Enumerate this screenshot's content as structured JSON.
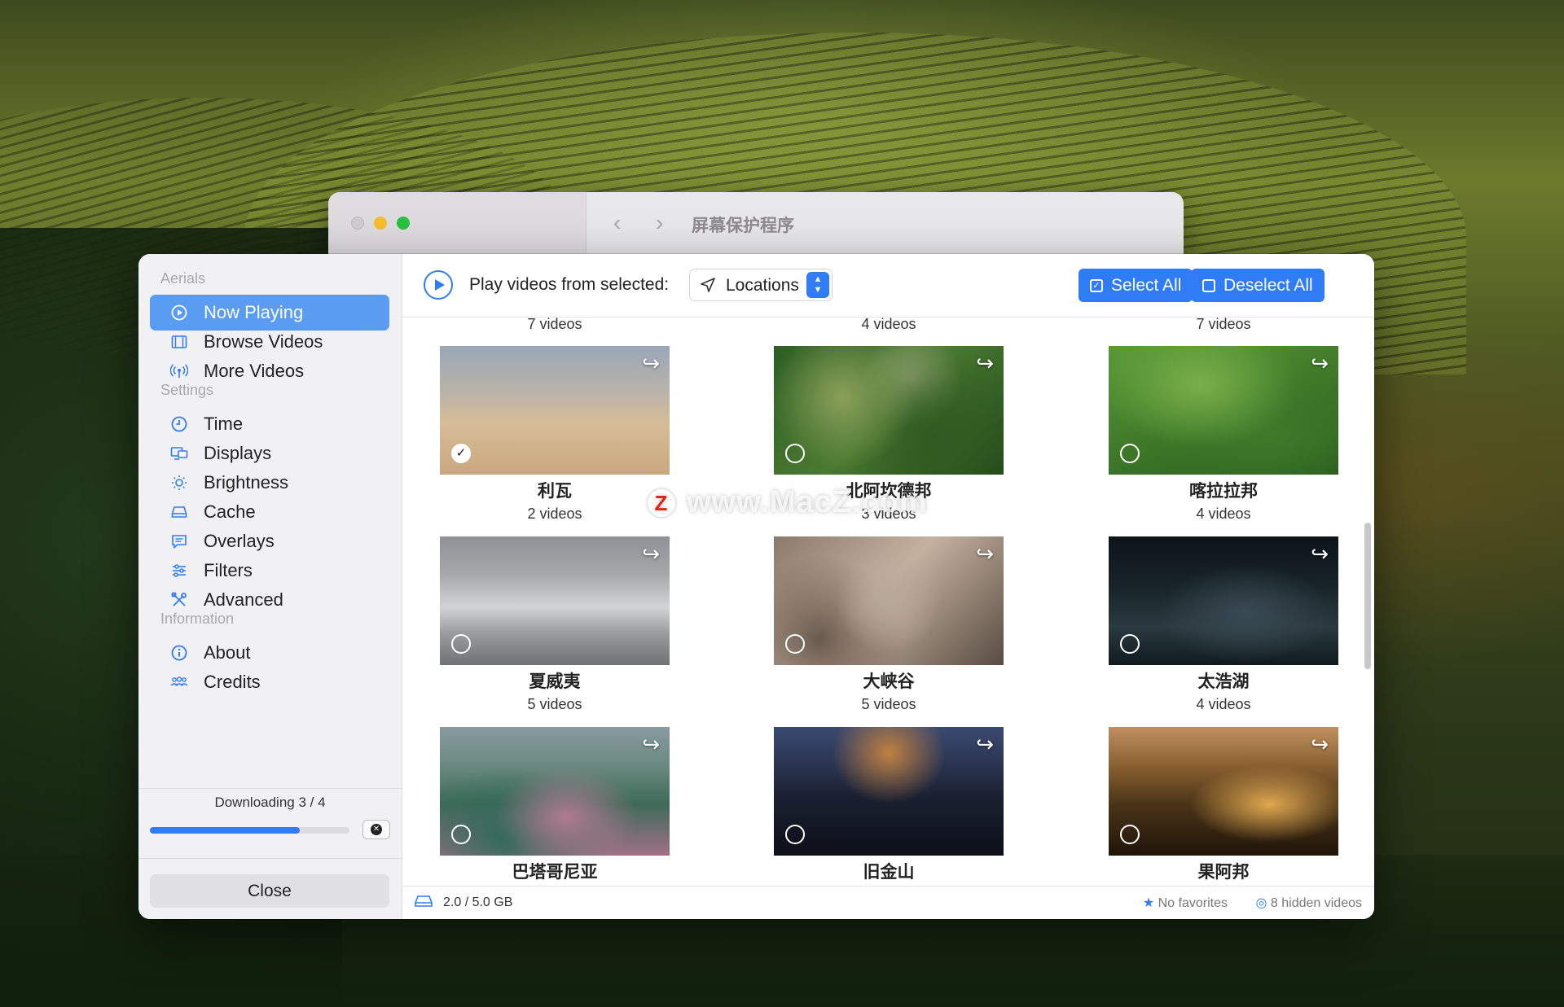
{
  "background_window": {
    "title": "屏幕保护程序"
  },
  "sidebar": {
    "sections": [
      {
        "label": "Aerials",
        "items": [
          {
            "label": "Now Playing",
            "icon": "play-circle-icon",
            "active": true
          },
          {
            "label": "Browse Videos",
            "icon": "film-icon"
          },
          {
            "label": "More Videos",
            "icon": "broadcast-icon"
          }
        ]
      },
      {
        "label": "Settings",
        "items": [
          {
            "label": "Time",
            "icon": "clock-icon"
          },
          {
            "label": "Displays",
            "icon": "displays-icon"
          },
          {
            "label": "Brightness",
            "icon": "sun-icon"
          },
          {
            "label": "Cache",
            "icon": "disk-icon"
          },
          {
            "label": "Overlays",
            "icon": "speech-bubble-icon"
          },
          {
            "label": "Filters",
            "icon": "sliders-icon"
          },
          {
            "label": "Advanced",
            "icon": "tools-icon"
          }
        ]
      },
      {
        "label": "Information",
        "items": [
          {
            "label": "About",
            "icon": "info-icon"
          },
          {
            "label": "Credits",
            "icon": "people-icon"
          }
        ]
      }
    ],
    "download": {
      "text": "Downloading 3 / 4",
      "progress": 0.75
    },
    "close_label": "Close"
  },
  "toolbar": {
    "play_label": "Play videos from selected:",
    "source_value": "Locations",
    "select_all": "Select All",
    "deselect_all": "Deselect All"
  },
  "grid": {
    "partial_counts": [
      "7 videos",
      "4 videos",
      "7 videos"
    ],
    "cards": [
      {
        "title": "利瓦",
        "count": "2 videos",
        "selected": true
      },
      {
        "title": "北阿坎德邦",
        "count": "3 videos",
        "selected": false
      },
      {
        "title": "喀拉拉邦",
        "count": "4 videos",
        "selected": false
      },
      {
        "title": "夏威夷",
        "count": "5 videos",
        "selected": false
      },
      {
        "title": "大峡谷",
        "count": "5 videos",
        "selected": false
      },
      {
        "title": "太浩湖",
        "count": "4 videos",
        "selected": false
      },
      {
        "title": "巴塔哥尼亚",
        "count": "",
        "selected": false
      },
      {
        "title": "旧金山",
        "count": "",
        "selected": false
      },
      {
        "title": "果阿邦",
        "count": "",
        "selected": false
      }
    ]
  },
  "status": {
    "disk_usage": "2.0 / 5.0 GB",
    "favorites": "No favorites",
    "hidden": "8 hidden videos"
  },
  "watermark": "www.MacZ.com",
  "colors": {
    "accent": "#2f7cf6",
    "sidebar_active": "#5a9cf2"
  }
}
